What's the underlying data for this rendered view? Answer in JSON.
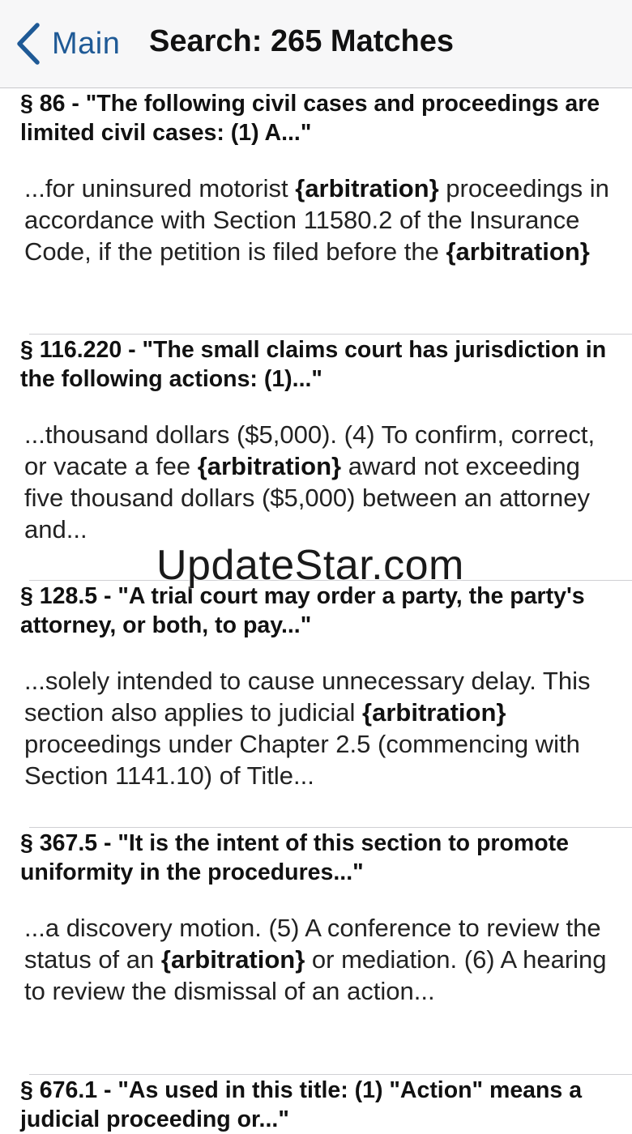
{
  "nav": {
    "back_label": "Main",
    "title": "Search: 265 Matches"
  },
  "results": [
    {
      "heading": "§ 86 - \"The following civil cases and proceedings are limited civil cases: (1) A...\"",
      "excerpt": [
        {
          "t": "...for uninsured motorist "
        },
        {
          "t": "{arbitration}",
          "b": true
        },
        {
          "t": " proceedings in accordance with Section 11580.2 of the Insurance Code, if the petition is filed before the "
        },
        {
          "t": "{arbitration}",
          "b": true
        }
      ]
    },
    {
      "heading": "§ 116.220 - \"The small claims court has jurisdiction in the following actions: (1)...\"",
      "excerpt": [
        {
          "t": "...thousand dollars ($5,000). (4) To confirm, correct, or vacate a fee "
        },
        {
          "t": "{arbitration}",
          "b": true
        },
        {
          "t": " award not exceeding five thousand dollars ($5,000) between an attorney and..."
        }
      ]
    },
    {
      "heading": "§ 128.5 - \"A trial court may order a party, the party's attorney, or both, to pay...\"",
      "excerpt": [
        {
          "t": "...solely intended to cause unnecessary delay. This section also applies to judicial "
        },
        {
          "t": "{arbitration}",
          "b": true
        },
        {
          "t": " proceedings under Chapter 2.5 (commencing with Section 1141.10) of Title..."
        }
      ]
    },
    {
      "heading": "§ 367.5 - \"It is the intent of this section to promote uniformity in the procedures...\"",
      "excerpt": [
        {
          "t": "...a discovery motion. (5) A conference to review the status of an "
        },
        {
          "t": "{arbitration}",
          "b": true
        },
        {
          "t": " or mediation. (6) A hearing to review the dismissal of an action..."
        }
      ]
    },
    {
      "heading": "§ 676.1 - \"As used in this title: (1) \"Action\" means a judicial proceeding or...\"",
      "excerpt": []
    }
  ],
  "watermark": "UpdateStar.com",
  "colors": {
    "accent": "#1f5a96",
    "navbar_bg": "#f7f7f8",
    "separator": "#d0d0d4"
  },
  "icons": {
    "back": "chevron-left-icon"
  }
}
